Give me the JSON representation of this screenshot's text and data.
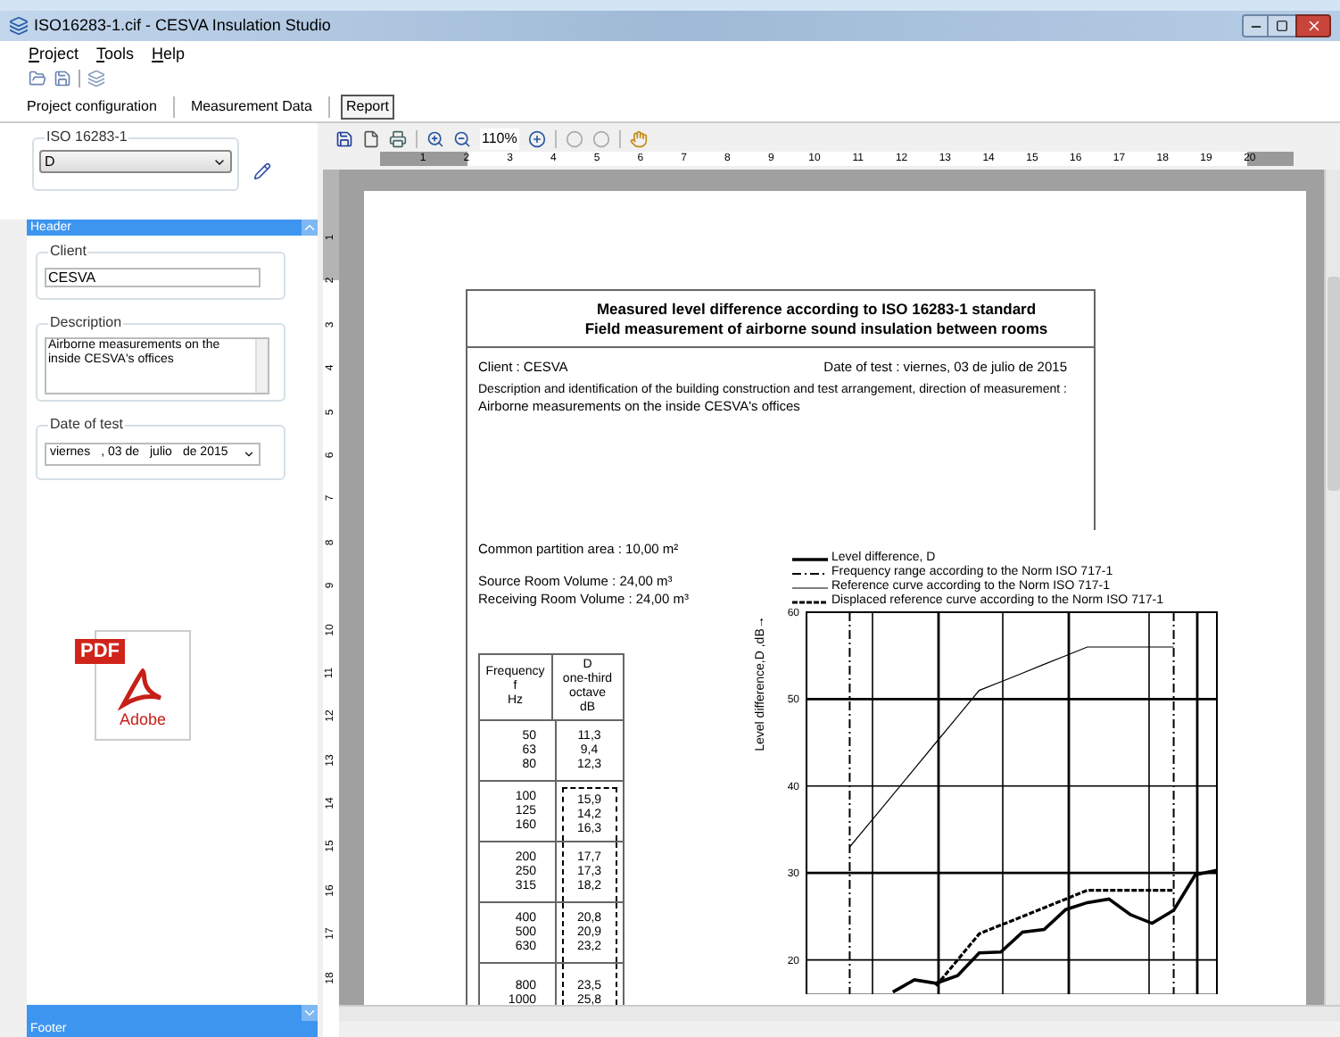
{
  "window": {
    "title": "ISO16283-1.cif - CESVA Insulation Studio"
  },
  "menu": [
    "Project",
    "Tools",
    "Help"
  ],
  "tabs": [
    {
      "label": "Project configuration",
      "selected": false
    },
    {
      "label": "Measurement Data",
      "selected": false
    },
    {
      "label": "Report",
      "selected": true
    }
  ],
  "left_panel": {
    "standard_group": {
      "legend": "ISO 16283-1",
      "value": "D"
    },
    "header_section": {
      "title": "Header",
      "client": {
        "label": "Client",
        "value": "CESVA"
      },
      "description": {
        "label": "Description",
        "value": "Airborne measurements on the inside CESVA's offices"
      },
      "date_of_test": {
        "label": "Date of test",
        "parts": [
          "viernes",
          ", 03 de",
          "julio",
          "de 2015"
        ]
      }
    },
    "pdf_badge": {
      "label": "PDF",
      "caption": "Adobe"
    },
    "footer_section": {
      "title": "Footer"
    }
  },
  "report_toolbar": {
    "zoom": "110%"
  },
  "ruler": [
    "1",
    "2",
    "3",
    "4",
    "5",
    "6",
    "7",
    "8",
    "9",
    "10",
    "11",
    "12",
    "13",
    "14",
    "15",
    "16",
    "17",
    "18",
    "19",
    "20"
  ],
  "vertical_ruler": [
    "1",
    "2",
    "3",
    "4",
    "5",
    "6",
    "7",
    "8",
    "9",
    "10",
    "11",
    "12",
    "13",
    "14",
    "15",
    "16",
    "17",
    "18"
  ],
  "report": {
    "title": "Measured level difference according to ISO 16283-1 standard",
    "subtitle": "Field measurement of airborne sound insulation between rooms",
    "client": "Client : CESVA",
    "date_of_test": "Date of test : viernes, 03 de julio de 2015",
    "description_heading": "Description and identification of the building construction and test arrangement, direction of measurement :",
    "description": "Airborne measurements on the inside CESVA's offices",
    "partition_area": "Common partition area : 10,00 m²",
    "source_volume": "Source Room Volume : 24,00 m³",
    "receiving_volume": "Receiving Room Volume : 24,00 m³",
    "table": {
      "columns": [
        [
          "Frequency",
          "f",
          "Hz"
        ],
        [
          "D",
          "one-third",
          "octave",
          "dB"
        ]
      ],
      "groups": [
        {
          "in_range": false,
          "rows": [
            [
              "50",
              "11,3"
            ],
            [
              "63",
              "9,4"
            ],
            [
              "80",
              "12,3"
            ]
          ]
        },
        {
          "in_range": true,
          "rows": [
            [
              "100",
              "15,9"
            ],
            [
              "125",
              "14,2"
            ],
            [
              "160",
              "16,3"
            ]
          ]
        },
        {
          "in_range": true,
          "rows": [
            [
              "200",
              "17,7"
            ],
            [
              "250",
              "17,3"
            ],
            [
              "315",
              "18,2"
            ]
          ]
        },
        {
          "in_range": true,
          "rows": [
            [
              "400",
              "20,8"
            ],
            [
              "500",
              "20,9"
            ],
            [
              "630",
              "23,2"
            ]
          ]
        },
        {
          "in_range": true,
          "rows": [
            [
              "800",
              "23,5"
            ],
            [
              "1000",
              "25,8"
            ]
          ]
        }
      ]
    },
    "chart": {
      "range_label": "Frequency range according to the Norm ISO 717-1",
      "chart_data": {
        "type": "line",
        "ylabel": "Level difference,D ,dB→",
        "yticks": [
          20,
          30,
          40,
          50,
          60
        ],
        "ylim": [
          16,
          60
        ],
        "grid": true,
        "legend": true,
        "series": [
          {
            "name": "Level difference, D",
            "line_style": "solid",
            "color": "#000000",
            "values": [
              null,
              null,
              null,
              null,
              16.3,
              17.7,
              17.3,
              18.2,
              20.8,
              20.9,
              23.2,
              23.5,
              25.8,
              26.6,
              27,
              25.2,
              24.2,
              25.7,
              29.8,
              30.3
            ]
          },
          {
            "name": "Reference curve according to the Norm ISO 717-1",
            "line_style": "solid",
            "color": "#000000",
            "values": [
              null,
              null,
              33,
              36,
              39,
              42,
              45,
              48,
              51,
              52,
              53,
              54,
              55,
              56,
              56,
              56,
              56,
              56,
              null,
              null
            ]
          },
          {
            "name": "Displaced reference curve according to the Norm ISO 717-1",
            "line_style": "dashed",
            "color": "#000000",
            "values": [
              null,
              null,
              null,
              null,
              null,
              null,
              17,
              20,
              23,
              24,
              25,
              26,
              27,
              28,
              28,
              28,
              28,
              28,
              null,
              null
            ]
          }
        ]
      }
    }
  }
}
